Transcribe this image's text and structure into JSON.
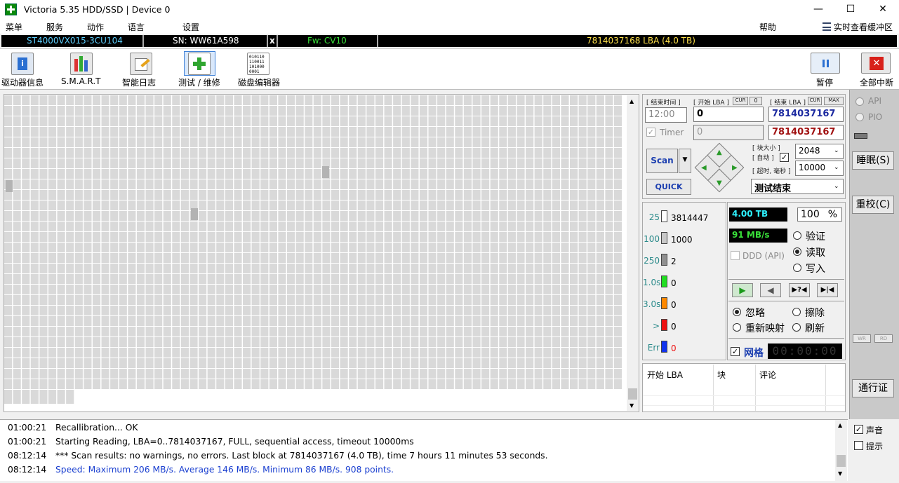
{
  "window": {
    "title": "Victoria 5.35 HDD/SSD | Device 0",
    "minimize": "—",
    "maximize": "☐",
    "close": "✕"
  },
  "menu": {
    "items": [
      "菜单",
      "服务",
      "动作",
      "语言",
      "设置"
    ],
    "help": "帮助",
    "realtime": "实时查看缓冲区"
  },
  "device": {
    "model": "ST4000VX015-3CU104",
    "serial": "SN: WW61A598",
    "x": "x",
    "firmware": "Fw: CV10",
    "capacity": "7814037168 LBA (4.0 TB)"
  },
  "toolbar": {
    "drive_info": "驱动器信息",
    "smart": "S.M.A.R.T",
    "smart_log": "智能日志",
    "test": "测试 / 维修",
    "disk_editor": "磁盘编辑器",
    "pause": "暂停",
    "abort_all": "全部中断",
    "editor_glyph": "010110\n110011\n101000\n0001"
  },
  "scan": {
    "end_time_label": "[ 结束时间 ]",
    "start_lba_label": "[ 开始 LBA ]",
    "cur": "CUR",
    "zero": "0",
    "end_lba_label": "[ 结束 LBA ]",
    "max": "MAX",
    "time_value": "12:00",
    "start_lba": "0",
    "end_lba": "7814037167",
    "timer_label": "Timer",
    "timer_value": "0",
    "end_lba_max": "7814037167",
    "scan_button": "Scan",
    "quick_button": "QUICK",
    "block_size_label": "[ 块大小 ]",
    "auto_label": "[ 自动 ]",
    "timeout_label": "[ 超时, 毫秒 ]",
    "block_size": "2048",
    "timeout": "10000",
    "status": "测试结束"
  },
  "counters": [
    {
      "label": "25",
      "value": "3814447",
      "color": "#ffffff"
    },
    {
      "label": "100",
      "value": "1000",
      "color": "#c8c8c8"
    },
    {
      "label": "250",
      "value": "2",
      "color": "#909090"
    },
    {
      "label": "1.0s",
      "value": "0",
      "color": "#22dd22"
    },
    {
      "label": "3.0s",
      "value": "0",
      "color": "#ff8800"
    },
    {
      "label": ">",
      "value": "0",
      "color": "#ee1111"
    },
    {
      "label": "Err",
      "value": "0",
      "color": "#1133ee"
    }
  ],
  "stats": {
    "size": "4.00 TB",
    "percent": "100",
    "percent_sign": "%",
    "speed": "91 MB/s",
    "ddd": "DDD (API)"
  },
  "modes": {
    "verify": "验证",
    "read": "读取",
    "write": "写入",
    "selected": "read"
  },
  "actions": {
    "ignore": "忽略",
    "erase": "擦除",
    "remap": "重新映射",
    "refresh": "刷新",
    "selected": "ignore"
  },
  "grid_option": {
    "label": "网格",
    "timer": "00:00:00"
  },
  "table": {
    "columns": [
      "开始 LBA",
      "块",
      "评论"
    ]
  },
  "side": {
    "api": "API",
    "pio": "PIO",
    "sleep": "睡眠(S)",
    "recalibrate": "重校(C)",
    "passport": "通行证",
    "wr": "WR",
    "rd": "RD",
    "sound": "声音",
    "hint": "提示"
  },
  "log": [
    {
      "time": "01:00:21",
      "text": "Recallibration... OK",
      "color": "#000000"
    },
    {
      "time": "01:00:21",
      "text": "Starting Reading, LBA=0..7814037167, FULL, sequential access, timeout 10000ms",
      "color": "#000000"
    },
    {
      "time": "08:12:14",
      "text": "*** Scan results: no warnings, no errors. Last block at 7814037167 (4.0 TB), time 7 hours 11 minutes 53 seconds.",
      "color": "#000000"
    },
    {
      "time": "08:12:14",
      "text": "Speed: Maximum 206 MB/s. Average 146 MB/s. Minimum 86 MB/s. 908 points.",
      "color": "#1a3fd0"
    }
  ]
}
